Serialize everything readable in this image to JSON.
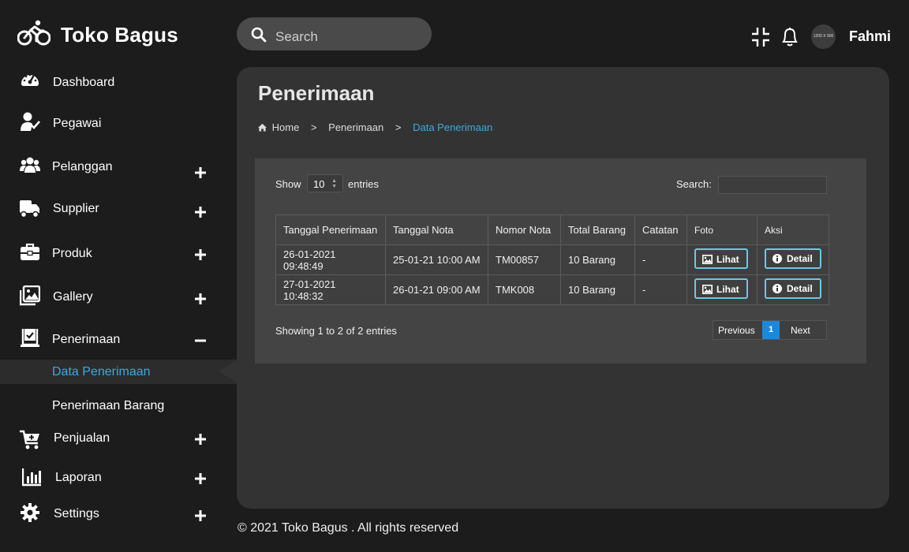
{
  "app": {
    "name": "Toko Bagus"
  },
  "sidebar": {
    "items": [
      {
        "label": "Dashboard",
        "icon": "gauge-icon",
        "expand": ""
      },
      {
        "label": "Pegawai",
        "icon": "user-check-icon",
        "expand": ""
      },
      {
        "label": "Pelanggan",
        "icon": "users-icon",
        "expand": "+"
      },
      {
        "label": "Supplier",
        "icon": "truck-icon",
        "expand": "+"
      },
      {
        "label": "Produk",
        "icon": "briefcase-icon",
        "expand": "+"
      },
      {
        "label": "Gallery",
        "icon": "images-icon",
        "expand": "+"
      },
      {
        "label": "Penerimaan",
        "icon": "clipboard-check-icon",
        "expand": "−"
      },
      {
        "label": "Penjualan",
        "icon": "cart-plus-icon",
        "expand": "+"
      },
      {
        "label": "Laporan",
        "icon": "bar-chart-icon",
        "expand": "+"
      },
      {
        "label": "Settings",
        "icon": "gear-icon",
        "expand": "+"
      }
    ],
    "sub_items": [
      {
        "label": "Data Penerimaan",
        "active": true
      },
      {
        "label": "Penerimaan Barang",
        "active": false
      }
    ]
  },
  "topbar": {
    "search_placeholder": "Search",
    "avatar_text": "1200 X 900",
    "username": "Fahmi"
  },
  "page": {
    "title": "Penerimaan",
    "breadcrumb": [
      "Home",
      "Penerimaan",
      "Data Penerimaan"
    ]
  },
  "table_controls": {
    "show_label": "Show",
    "entries_value": "10",
    "entries_label": "entries",
    "search_label": "Search:"
  },
  "table": {
    "headers": [
      "Tanggal Penerimaan",
      "Tanggal Nota",
      "Nomor Nota",
      "Total Barang",
      "Catatan",
      "Foto",
      "Aksi"
    ],
    "rows": [
      [
        "26-01-2021 09:48:49",
        "25-01-21 10:00 AM",
        "TM00857",
        "10 Barang",
        "-"
      ],
      [
        "27-01-2021 10:48:32",
        "26-01-21 09:00 AM",
        "TMK008",
        "10 Barang",
        "-"
      ]
    ],
    "view_button": "Lihat",
    "detail_button": "Detail"
  },
  "pagination": {
    "info": "Showing 1 to 2 of 2 entries",
    "previous": "Previous",
    "current_page": "1",
    "next": "Next"
  },
  "footer": {
    "text": "© 2021 Toko Bagus . All rights reserved"
  },
  "colors": {
    "accent": "#1e88d8",
    "link": "#3fa8e0",
    "button_border": "#6fc7e8"
  }
}
